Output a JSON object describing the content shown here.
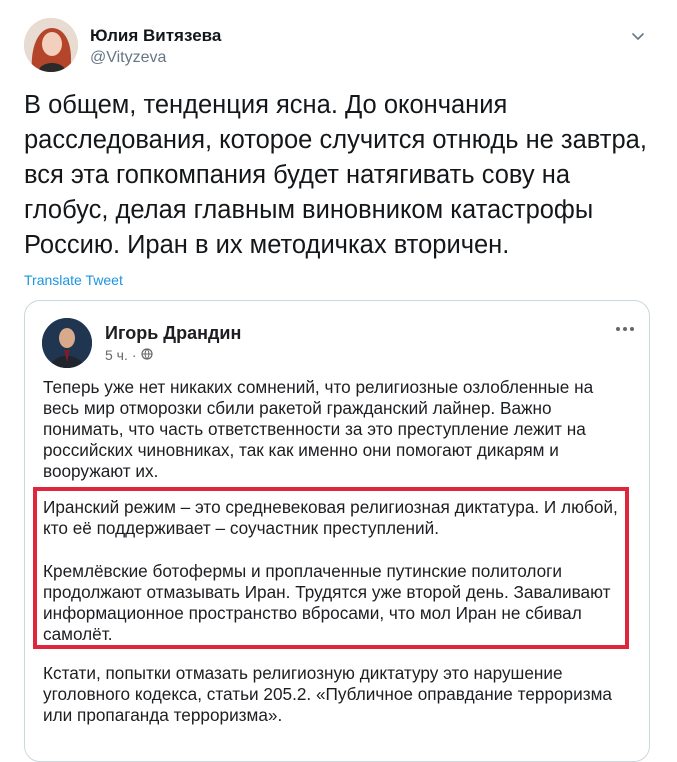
{
  "author": {
    "name": "Юлия Витязева",
    "handle": "@Vityzeva"
  },
  "tweet": {
    "text": "В общем, тенденция ясна. До окончания\nрасследования, которое случится отнюдь не завтра,\nвся эта гопкомпания будет натягивать сову на\nглобус, делая главным виновником катастрофы\nРоссию. Иран в их методичках вторичен.",
    "translate_label": "Translate Tweet"
  },
  "embedded_post": {
    "author": "Игорь Драндин",
    "time": "5 ч.",
    "separator": "·",
    "paragraphs": [
      "Теперь уже нет никаких сомнений, что религиозные озлобленные на весь мир отморозки сбили ракетой гражданский лайнер. Важно понимать, что часть ответственности за это преступление лежит на российских чиновниках, так как именно они помогают дикарям и вооружают их.",
      "Иранский режим – это средневековая религиозная диктатура. И любой, кто её поддерживает – соучастник преступлений.",
      "Кремлёвские ботофермы и проплаченные путинские политологи продолжают отмазывать Иран. Трудятся уже второй день. Заваливают информационное пространство вбросами, что мол Иран не сбивал самолёт.",
      "Кстати, попытки отмазать религиозную диктатуру это нарушение уголовного кодекса, статьи 205.2. «Публичное оправдание терроризма или пропаганда терроризма»."
    ],
    "highlight_color": "#e0263c"
  },
  "icons": {
    "caret": "chevron-down-icon",
    "more": "more-horizontal-icon",
    "privacy": "globe-icon"
  }
}
